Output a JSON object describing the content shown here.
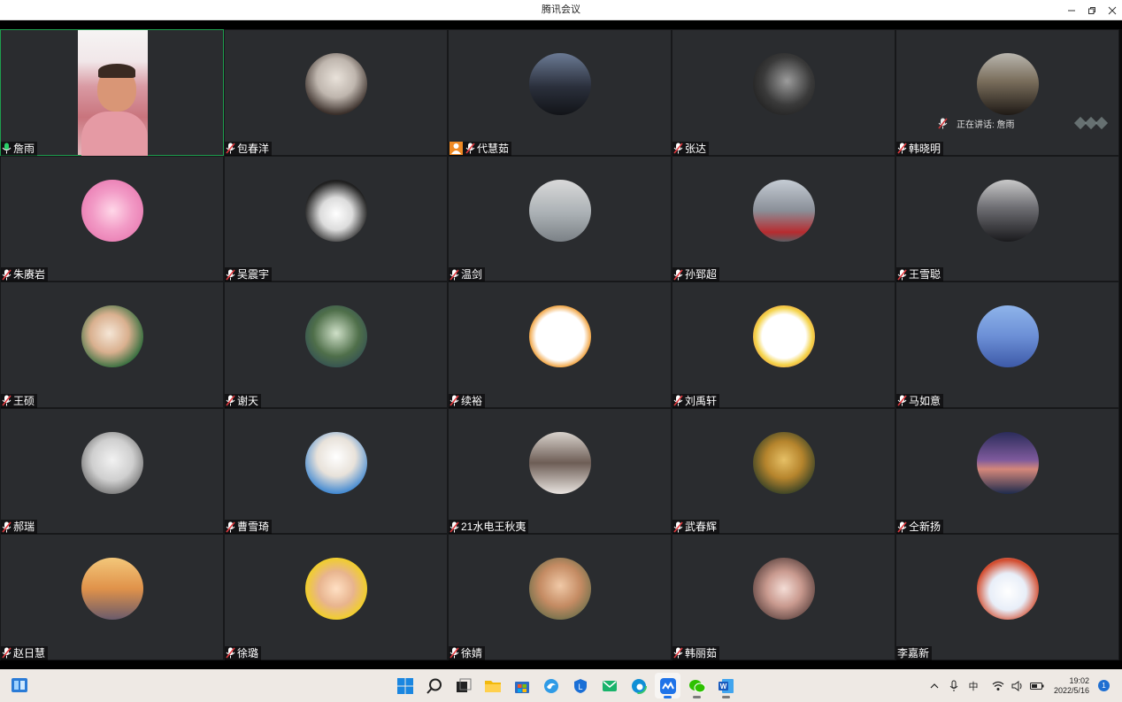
{
  "window": {
    "title": "腾讯会议"
  },
  "participants": [
    {
      "name": "詹雨",
      "mic": "on"
    },
    {
      "name": "包春洋",
      "mic": "muted"
    },
    {
      "name": "代慧茹",
      "mic": "muted",
      "host": true
    },
    {
      "name": "张达",
      "mic": "muted"
    },
    {
      "name": "韩晓明",
      "mic": "muted"
    },
    {
      "name": "朱赓岩",
      "mic": "muted"
    },
    {
      "name": "吴震宇",
      "mic": "muted"
    },
    {
      "name": "温剑",
      "mic": "muted"
    },
    {
      "name": "孙郅超",
      "mic": "muted"
    },
    {
      "name": "王雪聪",
      "mic": "muted"
    },
    {
      "name": "王硕",
      "mic": "muted"
    },
    {
      "name": "谢天",
      "mic": "muted"
    },
    {
      "name": "续裕",
      "mic": "muted"
    },
    {
      "name": "刘禹轩",
      "mic": "muted"
    },
    {
      "name": "马如意",
      "mic": "muted"
    },
    {
      "name": "郝瑞",
      "mic": "muted"
    },
    {
      "name": "曹雪琦",
      "mic": "muted"
    },
    {
      "name": "21水电王秋夷",
      "mic": "muted"
    },
    {
      "name": "武春辉",
      "mic": "muted"
    },
    {
      "name": "仝新扬",
      "mic": "muted"
    },
    {
      "name": "赵日慧",
      "mic": "muted"
    },
    {
      "name": "徐璐",
      "mic": "muted"
    },
    {
      "name": "徐婧",
      "mic": "muted"
    },
    {
      "name": "韩丽茹",
      "mic": "muted"
    },
    {
      "name": "李嘉新",
      "mic": "none"
    }
  ],
  "speaking_overlay": {
    "text": "正在讲话: 詹雨"
  },
  "taskbar": {
    "input_method": "中",
    "time": "19:02",
    "date": "2022/5/16",
    "notification_count": "1"
  },
  "colors": {
    "tile_bg": "#2a2c2f",
    "active_border": "#1e9e4e",
    "taskbar_bg": "#eee9e4"
  }
}
